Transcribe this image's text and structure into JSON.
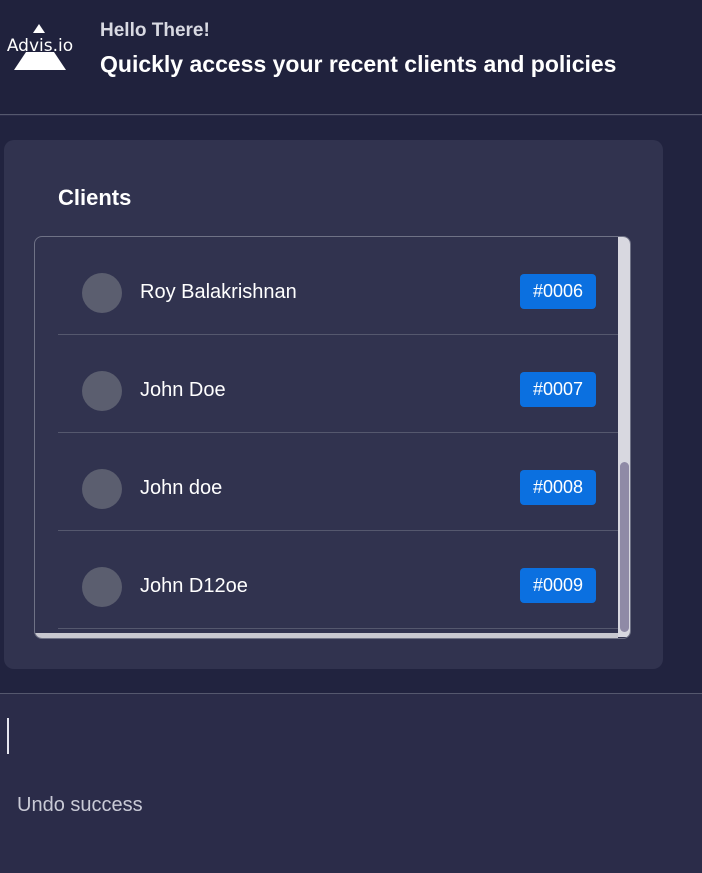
{
  "header": {
    "logo_text": "Advis.io",
    "greeting": "Hello There!",
    "subtitle": "Quickly access your recent clients and policies"
  },
  "clients": {
    "title": "Clients",
    "items": [
      {
        "name": "Roy Balakrishnan",
        "id": "#0006"
      },
      {
        "name": "John Doe",
        "id": "#0007"
      },
      {
        "name": "John doe",
        "id": "#0008"
      },
      {
        "name": "John D12oe",
        "id": "#0009"
      }
    ]
  },
  "status": {
    "message": "Undo success"
  },
  "colors": {
    "header_bg": "#20223d",
    "card_bg": "#31334f",
    "badge": "#0b70e0",
    "avatar": "#5b5e6f"
  }
}
